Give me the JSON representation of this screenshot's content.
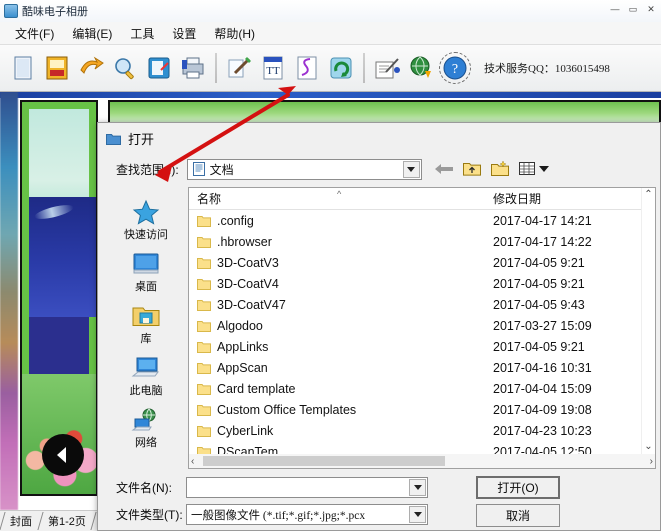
{
  "app": {
    "title": "酷味电子相册",
    "window_buttons": [
      "—",
      "▭",
      "✕"
    ],
    "menu": [
      {
        "label": "文件(F)"
      },
      {
        "label": "编辑(E)"
      },
      {
        "label": "工具"
      },
      {
        "label": "设置"
      },
      {
        "label": "帮助(H)"
      }
    ],
    "toolbar": {
      "buttons": [
        {
          "icon": "new-document-icon",
          "label": "新建"
        },
        {
          "icon": "open-album-icon",
          "label": "打开"
        },
        {
          "icon": "save-export-icon",
          "label": "保存"
        },
        {
          "icon": "preview-magnifier-icon",
          "label": "预览"
        },
        {
          "icon": "edit-page-icon",
          "label": "编辑"
        },
        {
          "icon": "print-icon",
          "label": "打印"
        },
        {
          "icon": "insert-picture-icon",
          "label": "插入图片"
        },
        {
          "icon": "insert-text-icon",
          "label": "插入文字"
        },
        {
          "icon": "insert-curve-icon",
          "label": "插入曲线"
        },
        {
          "icon": "refresh-icon",
          "label": "刷新"
        },
        {
          "icon": "notes-pen-icon",
          "label": "记事"
        },
        {
          "icon": "internet-download-icon",
          "label": "网络"
        },
        {
          "icon": "help-question-icon",
          "label": "帮助"
        }
      ],
      "service_text": "技术服务QQ：1036015498"
    },
    "sheet_tabs": [
      {
        "label": "封面"
      },
      {
        "label": "第1-2页"
      }
    ],
    "workspace": {
      "nav_back_icon": "back-arrow-circle-icon"
    }
  },
  "dialog": {
    "title": "打开",
    "title_icon": "folder-icon",
    "look_in": {
      "label": "查找范围(I):",
      "value": "文档",
      "value_icon": "documents-folder-icon"
    },
    "nav": {
      "back_icon": "back-arrow-icon",
      "up_icon": "up-folder-icon",
      "new_folder_icon": "new-folder-icon",
      "views_icon": "views-icon",
      "views_dropdown_icon": "chevron-down-icon"
    },
    "places": [
      {
        "label": "快速访问",
        "icon": "star-quick-access-icon"
      },
      {
        "label": "桌面",
        "icon": "desktop-icon"
      },
      {
        "label": "库",
        "icon": "library-folder-icon"
      },
      {
        "label": "此电脑",
        "icon": "this-pc-icon"
      },
      {
        "label": "网络",
        "icon": "network-icon"
      }
    ],
    "columns": [
      "名称",
      "修改日期"
    ],
    "sort_indicator": "^",
    "files": [
      {
        "name": ".config",
        "date": "2017-04-17 14:21"
      },
      {
        "name": ".hbrowser",
        "date": "2017-04-17 14:22"
      },
      {
        "name": "3D-CoatV3",
        "date": "2017-04-05 9:21"
      },
      {
        "name": "3D-CoatV4",
        "date": "2017-04-05 9:21"
      },
      {
        "name": "3D-CoatV47",
        "date": "2017-04-05 9:43"
      },
      {
        "name": "Algodoo",
        "date": "2017-03-27 15:09"
      },
      {
        "name": "AppLinks",
        "date": "2017-04-05 9:21"
      },
      {
        "name": "AppScan",
        "date": "2017-04-16 10:31"
      },
      {
        "name": "Card template",
        "date": "2017-04-04 15:09"
      },
      {
        "name": "Custom Office Templates",
        "date": "2017-04-09 19:08"
      },
      {
        "name": "CyberLink",
        "date": "2017-04-23 10:23"
      },
      {
        "name": "DScanTem",
        "date": "2017-04-05 12:50"
      }
    ],
    "scroll": {
      "up_arrow": "⌃",
      "down_arrow": "⌄",
      "left_arrow": "‹",
      "right_arrow": "›"
    },
    "file_name": {
      "label": "文件名(N):",
      "value": "",
      "placeholder": ""
    },
    "file_type": {
      "label": "文件类型(T):",
      "value": "一般图像文件 (*.tif;*.gif;*.jpg;*.pcx"
    },
    "buttons": {
      "open": "打开(O)",
      "cancel": "取消"
    }
  },
  "colors": {
    "dialog_bg": "#f0f0f0",
    "accent_blue": "#2b5fc8",
    "folder_yellow": "#fbe08a",
    "pointer_red": "#d41111"
  }
}
